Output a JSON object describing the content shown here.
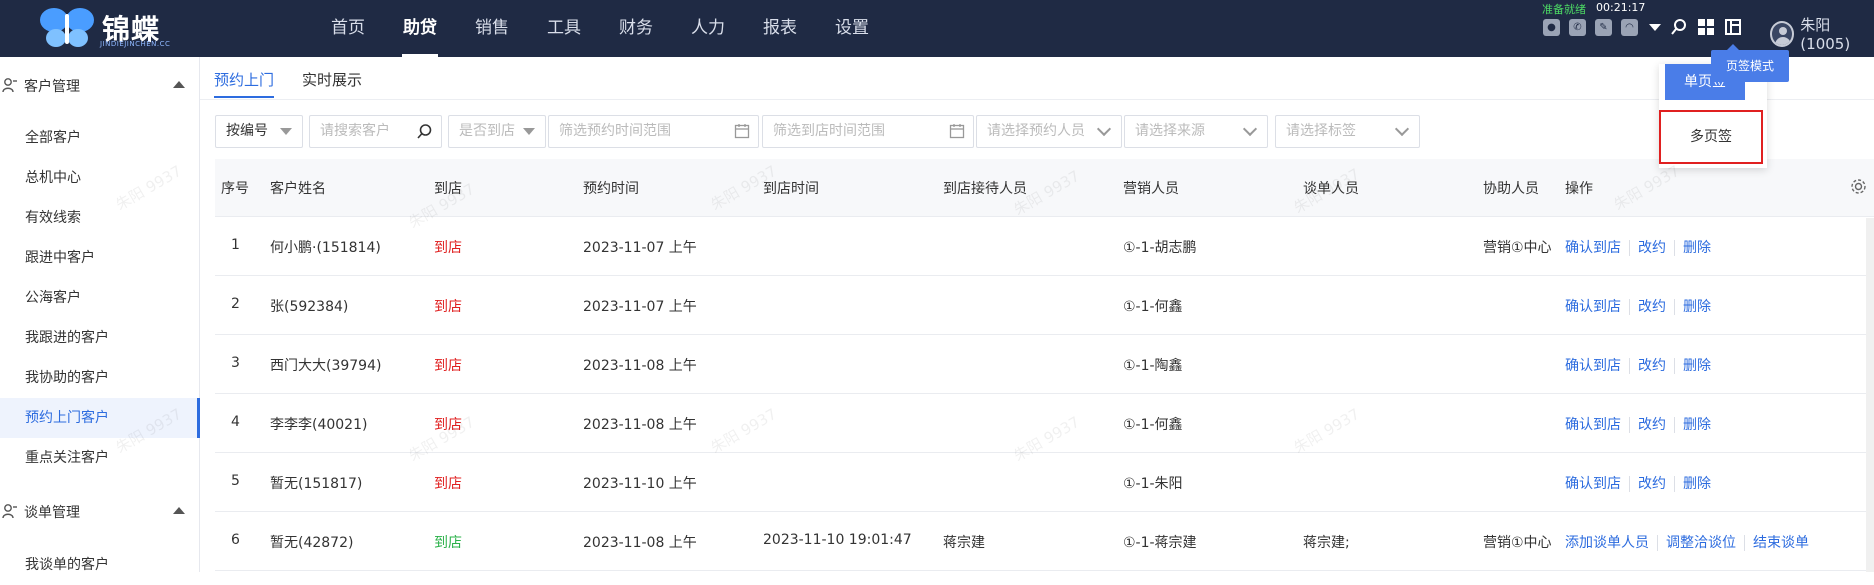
{
  "app": {
    "logo_text": "锦蝶",
    "logo_sub": "JINDIEJINCHEN.CC",
    "nav": [
      "首页",
      "助贷",
      "销售",
      "工具",
      "财务",
      "人力",
      "报表",
      "设置"
    ],
    "status_ready": "准备就绪",
    "status_time": "00:21:17",
    "user_name": "朱阳(1005)"
  },
  "sidebar": {
    "group1": "客户管理",
    "items": [
      "全部客户",
      "总机中心",
      "有效线索",
      "跟进中客户",
      "公海客户",
      "我跟进的客户",
      "我协助的客户",
      "预约上门客户",
      "重点关注客户"
    ],
    "active_index": 7,
    "group2": "谈单管理",
    "group2_items": [
      "我谈单的客户"
    ]
  },
  "tabs": [
    "预约上门",
    "实时展示"
  ],
  "filters": {
    "sort": "按编号",
    "search_placeholder": "请搜索客户",
    "arrived": "是否到店",
    "appt_range": "筛选预约时间范围",
    "arrive_range": "筛选到店时间范围",
    "appt_person": "请选择预约人员",
    "source": "请选择来源",
    "tags": "请选择标签"
  },
  "table": {
    "headers": [
      "序号",
      "客户姓名",
      "到店",
      "预约时间",
      "到店时间",
      "到店接待人员",
      "营销人员",
      "谈单人员",
      "协助人员",
      "操作"
    ],
    "rows": [
      {
        "no": "1",
        "name": "何小鹏·(151814)",
        "arrive": "到店",
        "arrive_status": "no",
        "appt": "2023-11-07 上午",
        "arrive_time": "",
        "receptionist": "",
        "sales": "①-1-胡志鹏",
        "negotiator": "",
        "assistant": "营销①中心",
        "actions": [
          "确认到店",
          "改约",
          "删除"
        ]
      },
      {
        "no": "2",
        "name": "张(592384)",
        "arrive": "到店",
        "arrive_status": "no",
        "appt": "2023-11-07 上午",
        "arrive_time": "",
        "receptionist": "",
        "sales": "①-1-何鑫",
        "negotiator": "",
        "assistant": "",
        "actions": [
          "确认到店",
          "改约",
          "删除"
        ]
      },
      {
        "no": "3",
        "name": "西门大大(39794)",
        "arrive": "到店",
        "arrive_status": "no",
        "appt": "2023-11-08 上午",
        "arrive_time": "",
        "receptionist": "",
        "sales": "①-1-陶鑫",
        "negotiator": "",
        "assistant": "",
        "actions": [
          "确认到店",
          "改约",
          "删除"
        ]
      },
      {
        "no": "4",
        "name": "李李李(40021)",
        "arrive": "到店",
        "arrive_status": "no",
        "appt": "2023-11-08 上午",
        "arrive_time": "",
        "receptionist": "",
        "sales": "①-1-何鑫",
        "negotiator": "",
        "assistant": "",
        "actions": [
          "确认到店",
          "改约",
          "删除"
        ]
      },
      {
        "no": "5",
        "name": "暂无(151817)",
        "arrive": "到店",
        "arrive_status": "no",
        "appt": "2023-11-10 上午",
        "arrive_time": "",
        "receptionist": "",
        "sales": "①-1-朱阳",
        "negotiator": "",
        "assistant": "",
        "actions": [
          "确认到店",
          "改约",
          "删除"
        ]
      },
      {
        "no": "6",
        "name": "暂无(42872)",
        "arrive": "到店",
        "arrive_status": "yes",
        "appt": "2023-11-08 上午",
        "arrive_time": "2023-11-10 19:01:47",
        "receptionist": "蒋宗建",
        "sales": "①-1-蒋宗建",
        "negotiator": "蒋宗建;",
        "assistant": "营销①中心",
        "actions": [
          "添加谈单人员",
          "调整洽谈位",
          "结束谈单"
        ]
      }
    ]
  },
  "popup": {
    "tooltip": "页签模式",
    "single": "单页签",
    "multi": "多页签"
  },
  "watermark": "朱阳 9937",
  "colors": {
    "topbar": "#1f2a44",
    "accent": "#2d6cdf",
    "not_arrived": "#e02020",
    "arrived": "#2bb14a",
    "highlight": "#e02020"
  }
}
